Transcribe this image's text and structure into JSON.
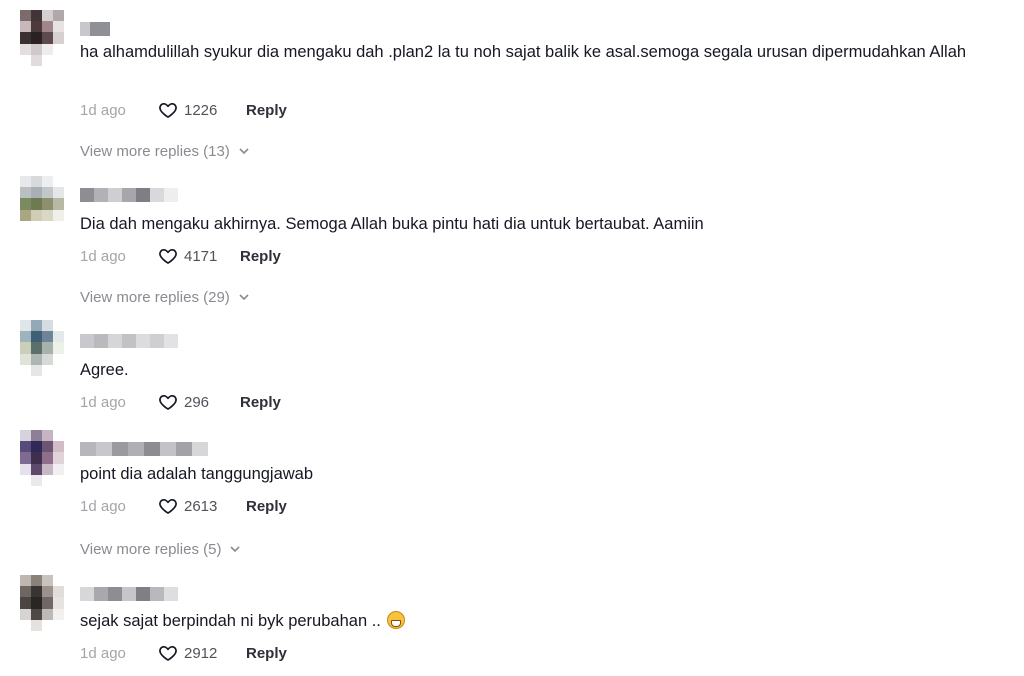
{
  "comments": [
    {
      "text": "ha alhamdulillah syukur dia mengaku dah .plan2 la tu noh sajat balik ke asal.semoga segala urusan dipermudahkan Allah",
      "time": "1d ago",
      "likes": "1226",
      "reply": "Reply",
      "more_replies": "View more replies (13)",
      "avatar_colors": [
        "#7d6a6c",
        "#413538",
        "#d4cfd0",
        "#b2a7a9",
        "#c7b9ba",
        "#4d3a3c",
        "#a0868a",
        "#e8e2e3",
        "#3a2f31",
        "#2a2123",
        "#5c4a4d",
        "#d6d0d1",
        "#e3dfe0",
        "#cfc9ca",
        "#efecec",
        "#ffffff",
        "#ffffff",
        "#e0dcdd",
        "#ffffff",
        "#ffffff"
      ],
      "username_colors": [
        "#c8c8cc",
        "#8f9095",
        "#8f9095"
      ]
    },
    {
      "text": "Dia dah mengaku akhirnya. Semoga Allah buka pintu hati dia untuk bertaubat. Aamiin",
      "time": "1d ago",
      "likes": "4171",
      "reply": "Reply",
      "more_replies": "View more replies (29)",
      "avatar_colors": [
        "#e6e8ea",
        "#d7dadc",
        "#eceef0",
        "#ffffff",
        "#b9bfc3",
        "#a9b0b5",
        "#c2c7ca",
        "#e4e6e8",
        "#7c8a61",
        "#6e7a52",
        "#8d8f6f",
        "#b7b8a6",
        "#a8a781",
        "#cfcdb3",
        "#dad8c4",
        "#f1f0e8",
        "#ffffff",
        "#ffffff",
        "#ffffff",
        "#ffffff"
      ],
      "username_colors": [
        "#8d8d92",
        "#b2b2b6",
        "#cfcfd2",
        "#a6a6ab",
        "#7e7e84",
        "#d9d9dc",
        "#eeeeef"
      ]
    },
    {
      "text": "Agree.",
      "time": "1d ago",
      "likes": "296",
      "reply": "Reply",
      "more_replies": "",
      "avatar_colors": [
        "#dfe6ea",
        "#94a9b6",
        "#d6dde1",
        "#ffffff",
        "#9fb3bf",
        "#3f5f74",
        "#6d8596",
        "#e3e8eb",
        "#c9cfb8",
        "#5d6f6a",
        "#a7b3aa",
        "#eef0ea",
        "#dfe3d8",
        "#aeb6b4",
        "#d6d9d6",
        "#ffffff",
        "#ffffff",
        "#e6e6e6",
        "#ffffff",
        "#ffffff"
      ],
      "username_colors": [
        "#c9c9cd",
        "#b9b9be",
        "#d6d6d9",
        "#c2c2c6",
        "#dcdcdf",
        "#cfcfd3",
        "#e2e2e5"
      ]
    },
    {
      "text": "point dia adalah tanggungjawab",
      "time": "1d ago",
      "likes": "2613",
      "reply": "Reply",
      "more_replies": "View more replies (5)",
      "avatar_colors": [
        "#d8d2dd",
        "#8d7f98",
        "#c7b3c3",
        "#ffffff",
        "#564c7a",
        "#2f2a55",
        "#6b5572",
        "#d2bdc6",
        "#7d6b93",
        "#3f2f4e",
        "#8e6e89",
        "#e2d3da",
        "#e6e0ec",
        "#5c4a6c",
        "#c8b8c6",
        "#f2eef1",
        "#ffffff",
        "#ece8ee",
        "#ffffff",
        "#ffffff"
      ],
      "username_colors": [
        "#b7b7bb",
        "#c8c8cc",
        "#9a9a9f",
        "#b0b0b4",
        "#8c8c91",
        "#c3c3c7",
        "#a2a2a7",
        "#d7d7da"
      ]
    },
    {
      "text": "sejak sajat berpindah ni byk perubahan ..",
      "time": "1d ago",
      "likes": "2912",
      "reply": "Reply",
      "more_replies": "",
      "avatar_colors": [
        "#bdb6b1",
        "#8b817b",
        "#c9c3bf",
        "#ffffff",
        "#6e6661",
        "#3a3532",
        "#9b928d",
        "#e1ddda",
        "#4a4542",
        "#2a2624",
        "#6f6864",
        "#e6e3e1",
        "#d7d3d1",
        "#4d4846",
        "#bfb9b6",
        "#f3f1f0",
        "#ffffff",
        "#e4e1df",
        "#ffffff",
        "#ffffff"
      ],
      "username_colors": [
        "#d7d7da",
        "#a9a9ad",
        "#8d8d92",
        "#c6c6ca",
        "#7f7f84",
        "#b9b9bd",
        "#dedee1"
      ]
    }
  ],
  "icons": {
    "like": "heart-outline-icon",
    "more": "chevron-down-icon",
    "emoji": "grinning-face-emoji"
  }
}
